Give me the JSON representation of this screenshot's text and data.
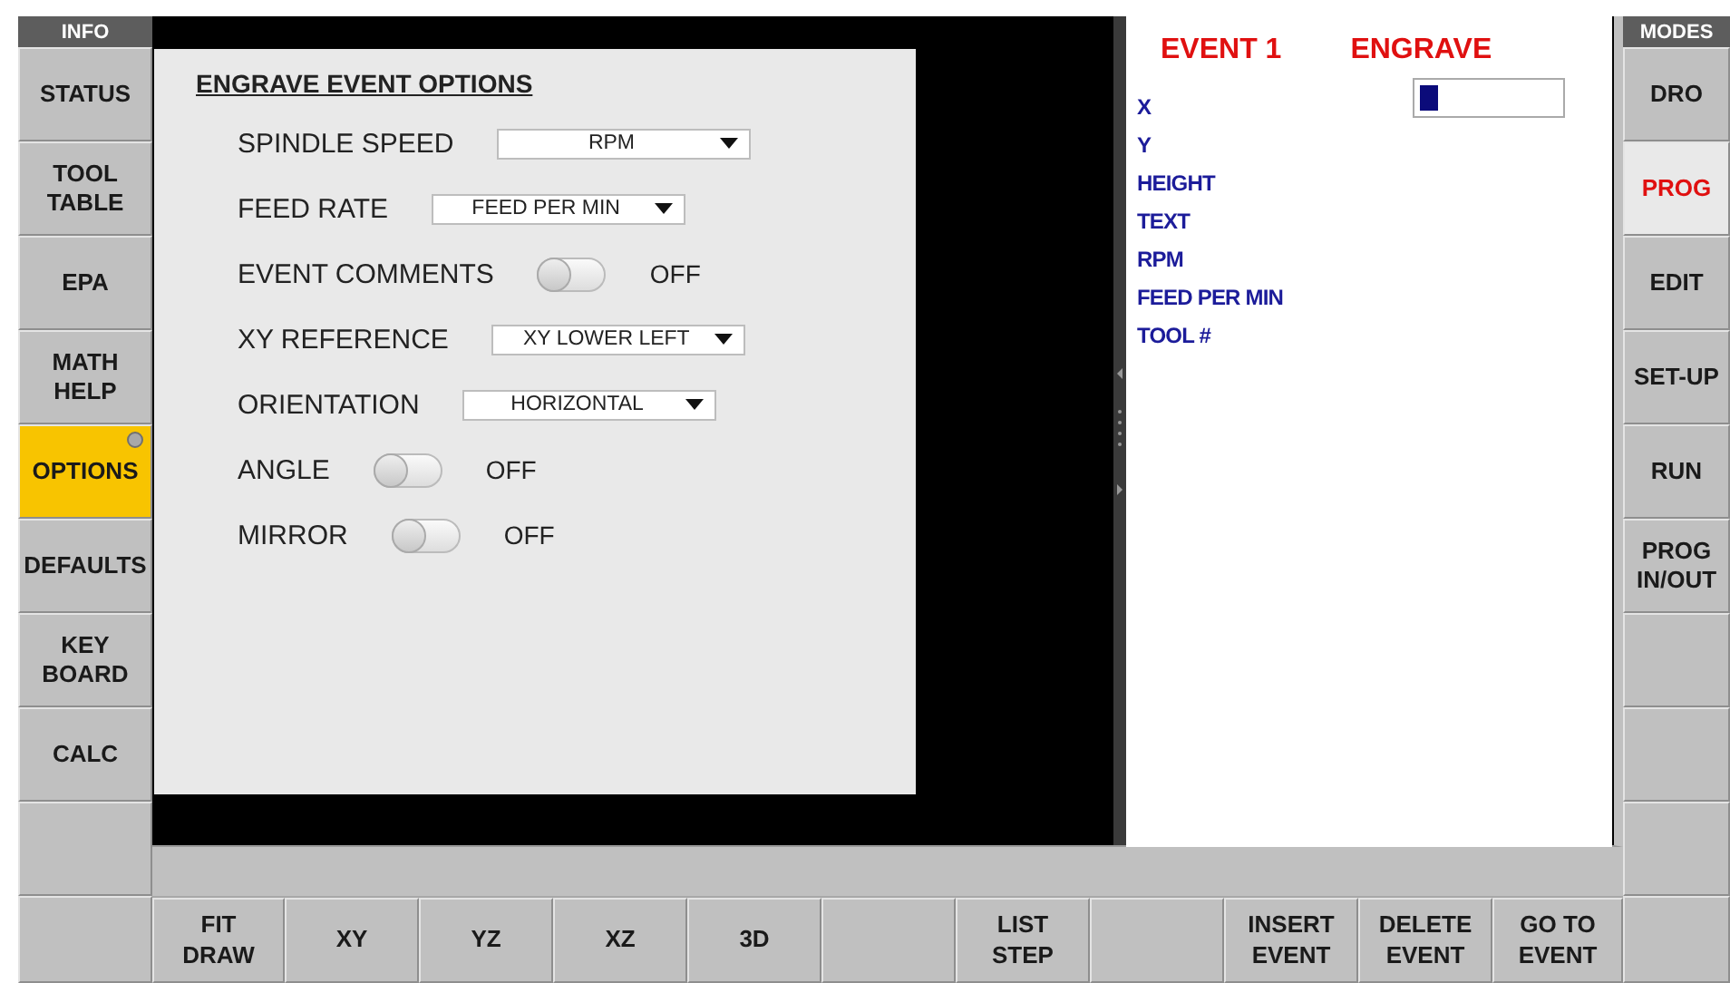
{
  "info_column": {
    "header": "INFO",
    "buttons": [
      {
        "label": "STATUS",
        "selected": false
      },
      {
        "label": "TOOL TABLE",
        "selected": false
      },
      {
        "label": "EPA",
        "selected": false
      },
      {
        "label": "MATH HELP",
        "selected": false
      },
      {
        "label": "OPTIONS",
        "selected": true
      },
      {
        "label": "DEFAULTS",
        "selected": false
      },
      {
        "label": "KEY BOARD",
        "selected": false
      },
      {
        "label": "CALC",
        "selected": false
      },
      {
        "kind": "blank"
      },
      {
        "kind": "blank"
      }
    ]
  },
  "options_panel": {
    "title": "ENGRAVE EVENT OPTIONS",
    "rows": [
      {
        "kind": "dropdown",
        "label": "SPINDLE SPEED",
        "value": "RPM"
      },
      {
        "kind": "dropdown",
        "label": "FEED RATE",
        "value": "FEED PER MIN"
      },
      {
        "kind": "toggle",
        "label": "EVENT COMMENTS",
        "on": false,
        "state_text": "OFF"
      },
      {
        "kind": "dropdown",
        "label": "XY REFERENCE",
        "value": "XY LOWER LEFT"
      },
      {
        "kind": "dropdown",
        "label": "ORIENTATION",
        "value": "HORIZONTAL"
      },
      {
        "kind": "toggle",
        "label": "ANGLE",
        "on": false,
        "state_text": "OFF"
      },
      {
        "kind": "toggle",
        "label": "MIRROR",
        "on": false,
        "state_text": "OFF"
      }
    ]
  },
  "event_pane": {
    "event": "EVENT 1",
    "type": "ENGRAVE",
    "fields": [
      "X",
      "Y",
      "HEIGHT",
      "TEXT",
      "RPM",
      "FEED PER MIN",
      "TOOL #"
    ]
  },
  "modes_column": {
    "header": "MODES",
    "buttons": [
      {
        "label": "DRO",
        "selected": false
      },
      {
        "label": "PROG",
        "selected": true
      },
      {
        "label": "EDIT",
        "selected": false
      },
      {
        "label": "SET-UP",
        "selected": false
      },
      {
        "label": "RUN",
        "selected": false
      },
      {
        "label": "PROG IN/OUT",
        "selected": false
      },
      {
        "kind": "blank"
      },
      {
        "kind": "blank"
      },
      {
        "kind": "blank"
      },
      {
        "kind": "blank"
      }
    ]
  },
  "bottom_bar": [
    {
      "label": "FIT DRAW"
    },
    {
      "label": "XY"
    },
    {
      "label": "YZ"
    },
    {
      "label": "XZ"
    },
    {
      "label": "3D"
    },
    {
      "kind": "blank"
    },
    {
      "label": "LIST STEP"
    },
    {
      "kind": "blank"
    },
    {
      "label": "INSERT EVENT"
    },
    {
      "label": "DELETE EVENT"
    },
    {
      "label": "GO TO EVENT"
    }
  ]
}
